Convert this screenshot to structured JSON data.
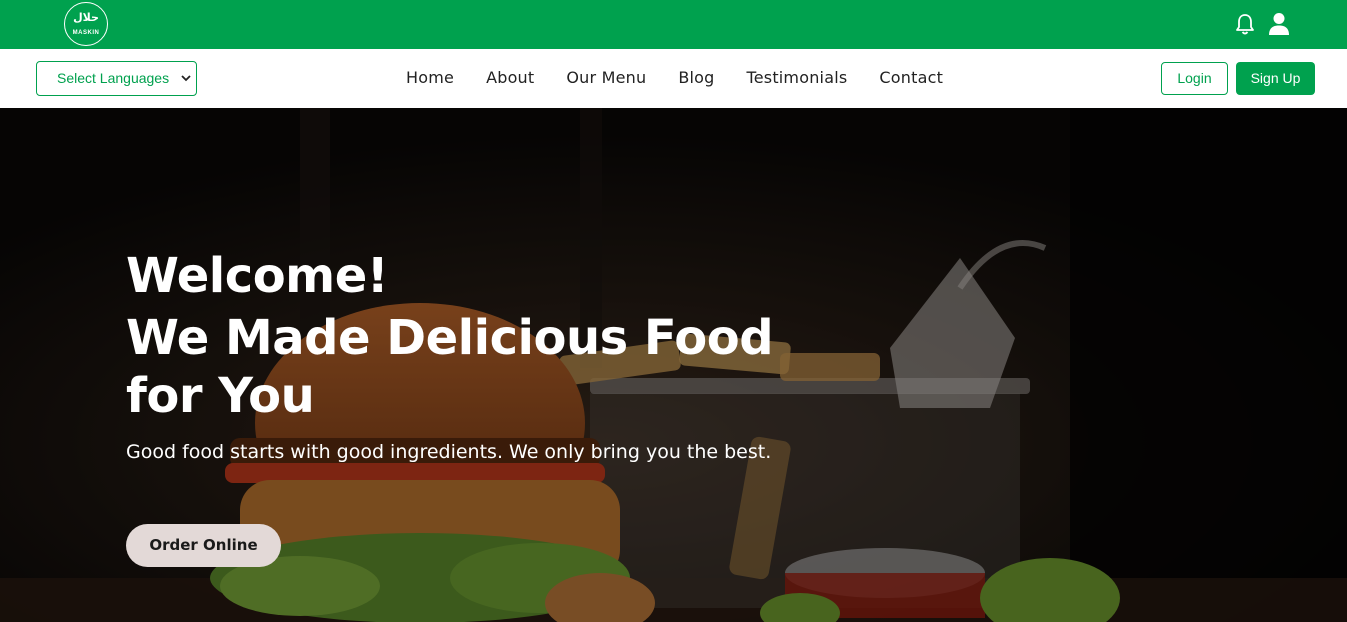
{
  "header": {
    "logo": {
      "arabic": "حلال",
      "brand": "MASKIN"
    },
    "icons": [
      "bell-icon",
      "user-icon"
    ],
    "accent_color": "#00a14e"
  },
  "navbar": {
    "language_select": {
      "value": "Select Languages"
    },
    "links": [
      "Home",
      "About",
      "Our Menu",
      "Blog",
      "Testimonials",
      "Contact"
    ],
    "login_label": "Login",
    "signup_label": "Sign Up"
  },
  "hero": {
    "welcome": "Welcome!",
    "title": "We Made Delicious Food for You",
    "subtitle": "Good food starts with good ingredients. We only bring you the best.",
    "cta_label": "Order Online",
    "cta_color": "#e3d9d7"
  }
}
